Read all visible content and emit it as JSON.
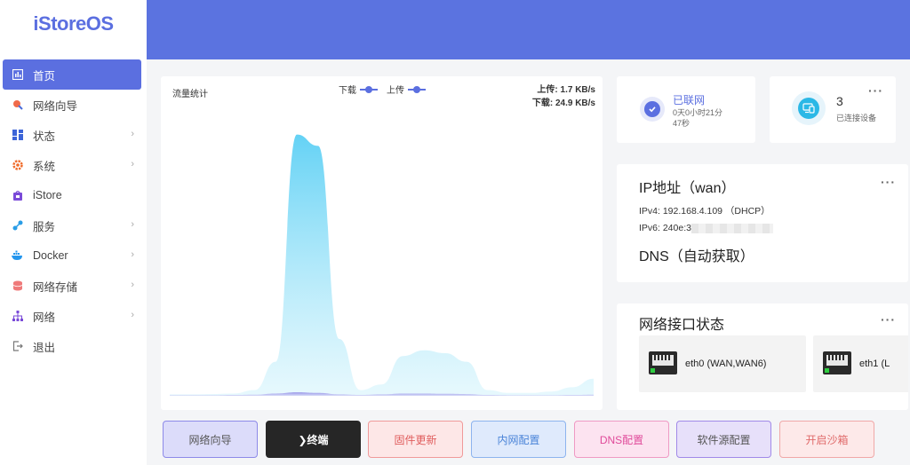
{
  "app": {
    "logo": "iStoreOS"
  },
  "sidebar": {
    "items": [
      {
        "label": "首页",
        "icon": "dashboard-icon",
        "active": true
      },
      {
        "label": "网络向导",
        "icon": "wizard-icon"
      },
      {
        "label": "状态",
        "icon": "status-icon"
      },
      {
        "label": "系统",
        "icon": "system-icon"
      },
      {
        "label": "iStore",
        "icon": "store-icon"
      },
      {
        "label": "服务",
        "icon": "services-icon"
      },
      {
        "label": "Docker",
        "icon": "docker-icon"
      },
      {
        "label": "网络存储",
        "icon": "storage-icon"
      },
      {
        "label": "网络",
        "icon": "network-icon"
      },
      {
        "label": "退出",
        "icon": "logout-icon"
      }
    ]
  },
  "traffic": {
    "title": "流量统计",
    "legend_download": "下载",
    "legend_upload": "上传",
    "upload_speed": "上传: 1.7 KB/s",
    "download_speed": "下载: 24.9 KB/s"
  },
  "status": {
    "title": "已联网",
    "uptime": "0天0小时21分47秒"
  },
  "devices": {
    "count": "3",
    "label": "已连接设备"
  },
  "ip": {
    "title": "IP地址（wan）",
    "ipv4": "IPv4:  192.168.4.109 （DHCP）",
    "ipv6_prefix": "IPv6:  240e:3",
    "dns_title": "DNS（自动获取）"
  },
  "network": {
    "title": "网络接口状态",
    "ports": [
      {
        "label": "eth0 (WAN,WAN6)"
      },
      {
        "label": "eth1 (L"
      }
    ]
  },
  "buttons": [
    {
      "label": "网络向导"
    },
    {
      "label": "❯终端"
    },
    {
      "label": "固件更新"
    },
    {
      "label": "内网配置"
    },
    {
      "label": "DNS配置"
    },
    {
      "label": "软件源配置"
    },
    {
      "label": "开启沙箱"
    }
  ],
  "colors": {
    "accent": "#5b6fe0",
    "header": "#5b73e0",
    "download_fill": "#6fd5f5",
    "upload_fill": "#8e88e6"
  },
  "chart_data": {
    "type": "area",
    "series": [
      {
        "name": "下载",
        "values": [
          0.5,
          0.5,
          0.6,
          0.8,
          2,
          12,
          92,
          88,
          20,
          2,
          4,
          14,
          16,
          15,
          12,
          2,
          1,
          1,
          1.5,
          3,
          6
        ]
      },
      {
        "name": "上传",
        "values": [
          0.2,
          0.2,
          0.2,
          0.3,
          0.4,
          0.8,
          1.2,
          1,
          0.5,
          0.3,
          0.5,
          0.8,
          0.8,
          0.7,
          0.6,
          0.3,
          0.2,
          0.2,
          0.2,
          0.3,
          0.4
        ]
      }
    ],
    "ylim": [
      0,
      100
    ],
    "grid": false,
    "legend": "top-center"
  }
}
